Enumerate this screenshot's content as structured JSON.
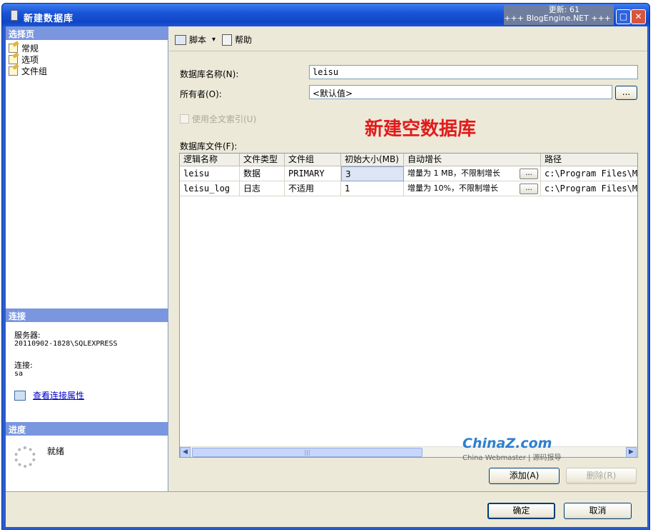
{
  "window": {
    "title": "新建数据库",
    "update_line1": "更新: 61",
    "update_line2": "+++ BlogEngine.NET +++",
    "maximize": "□",
    "close": "✕"
  },
  "left_panel": {
    "select_page_header": "选择页",
    "items": [
      {
        "label": "常规",
        "icon": "page-icon"
      },
      {
        "label": "选项",
        "icon": "page-icon"
      },
      {
        "label": "文件组",
        "icon": "page-icon"
      }
    ],
    "connection_header": "连接",
    "server_label": "服务器:",
    "server_value": "20110902-1828\\SQLEXPRESS",
    "connection_label": "连接:",
    "connection_value": "sa",
    "view_props_link": "查看连接属性",
    "progress_header": "进度",
    "progress_status": "就绪"
  },
  "toolbar": {
    "script_label": "脚本",
    "script_dropdown": "▾",
    "help_label": "帮助"
  },
  "form": {
    "db_name_label": "数据库名称(N):",
    "db_name_value": "leisu",
    "owner_label": "所有者(O):",
    "owner_value": "<默认值>",
    "browse_label": "...",
    "fulltext_label": "使用全文索引(U)",
    "annotation": "新建空数据库",
    "db_files_label": "数据库文件(F):"
  },
  "grid": {
    "columns": [
      "逻辑名称",
      "文件类型",
      "文件组",
      "初始大小(MB)",
      "自动增长",
      "路径"
    ],
    "rows": [
      {
        "name": "leisu",
        "type": "数据",
        "filegroup": "PRIMARY",
        "size": "3",
        "growth": "增量为 1 MB，不限制增长",
        "path": "c:\\Program Files\\Micro"
      },
      {
        "name": "leisu_log",
        "type": "日志",
        "filegroup": "不适用",
        "size": "1",
        "growth": "增量为 10%，不限制增长",
        "path": "c:\\Program Files\\Micro"
      }
    ],
    "cell_button": "...",
    "scroll_left": "◀",
    "scroll_right": "▶",
    "scroll_grip": "|||"
  },
  "watermark": {
    "main": "ChinaZ.com",
    "sub": "China Webmaster | 源码报导"
  },
  "buttons": {
    "add": "添加(A)",
    "remove": "删除(R)",
    "ok": "确定",
    "cancel": "取消"
  }
}
